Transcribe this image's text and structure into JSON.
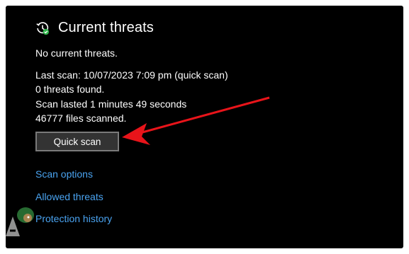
{
  "section": {
    "title": "Current threats",
    "icon": "history-clock-check-icon"
  },
  "status": {
    "no_threats": "No current threats.",
    "last_scan": "Last scan: 10/07/2023 7:09 pm (quick scan)",
    "threats_found": "0 threats found.",
    "scan_duration": "Scan lasted 1 minutes 49 seconds",
    "files_scanned": "46777 files scanned."
  },
  "actions": {
    "quick_scan_label": "Quick scan"
  },
  "links": {
    "scan_options": "Scan options",
    "allowed_threats": "Allowed threats",
    "protection_history": "Protection history"
  },
  "annotation": {
    "arrow_color": "#e8141a"
  },
  "colors": {
    "background": "#000000",
    "text": "#ffffff",
    "link": "#4aa3f0",
    "check_badge": "#2fb34a",
    "button_bg": "#333333",
    "button_border": "#7a7a7a"
  }
}
